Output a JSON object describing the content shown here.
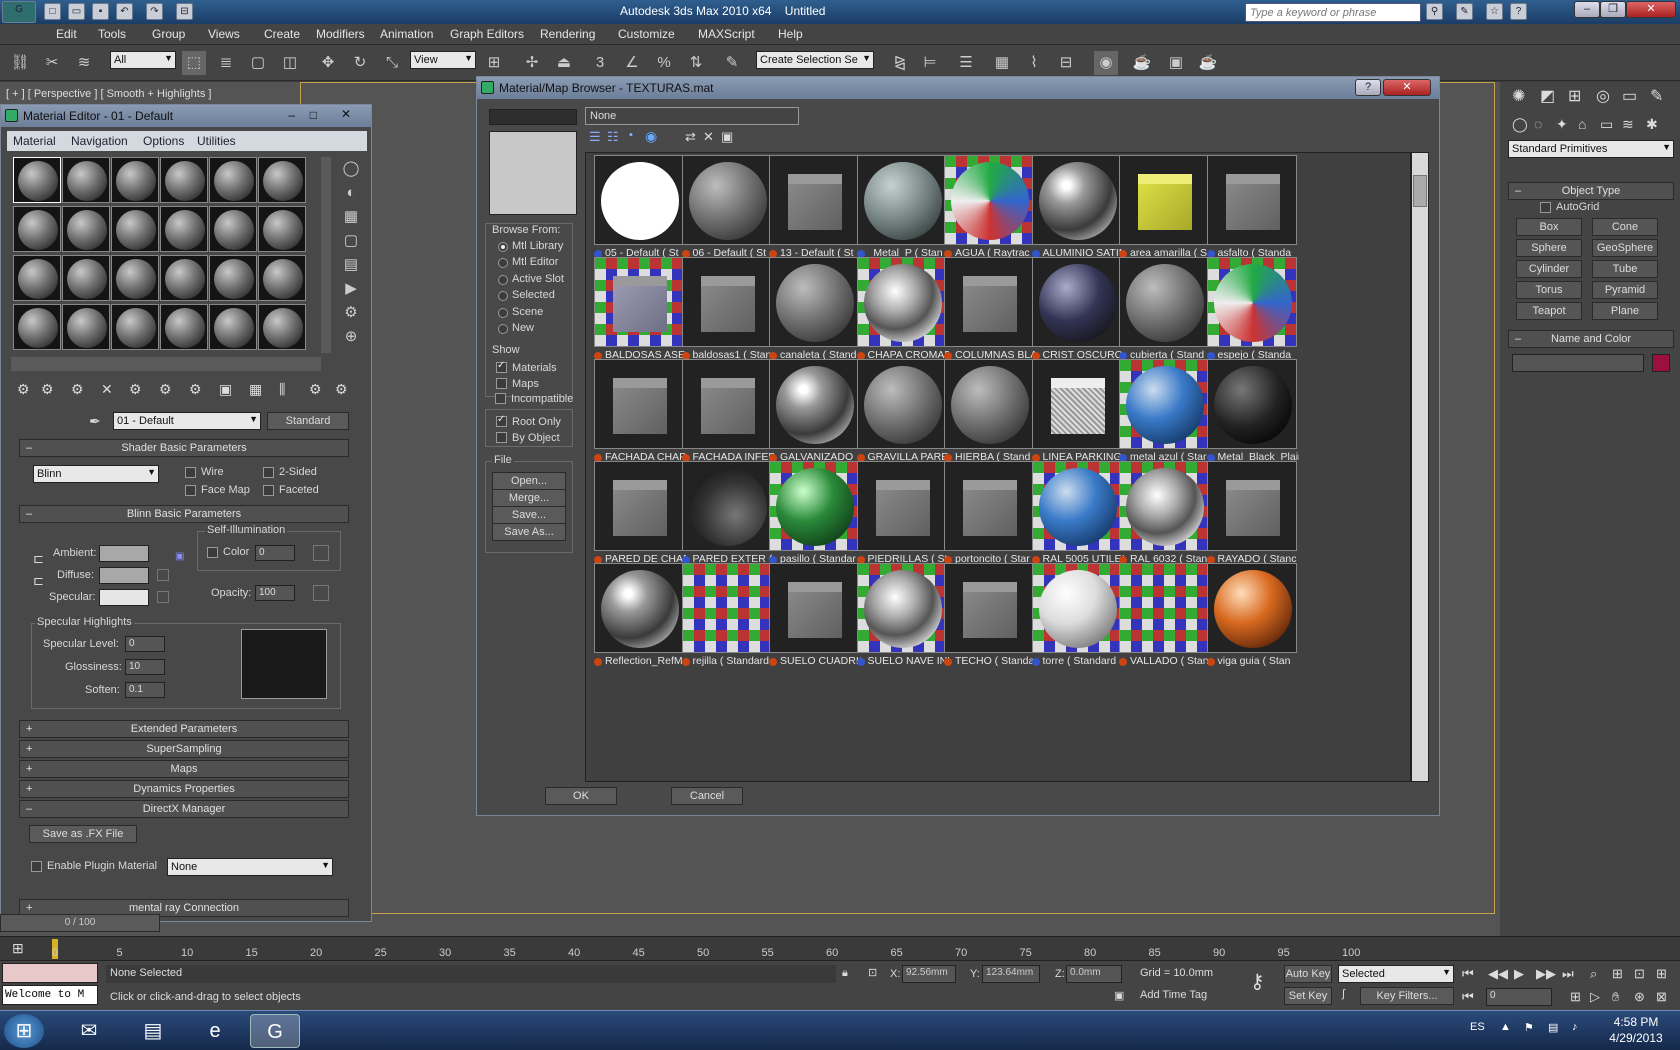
{
  "app": {
    "title": "Autodesk 3ds Max  2010 x64",
    "document": "Untitled",
    "search_placeholder": "Type a keyword or phrase"
  },
  "menu": [
    "Edit",
    "Tools",
    "Group",
    "Views",
    "Create",
    "Modifiers",
    "Animation",
    "Graph Editors",
    "Rendering",
    "Customize",
    "MAXScript",
    "Help"
  ],
  "toolbar": {
    "filter": "All",
    "ref_coord": "View",
    "selection_set": "Create Selection Se"
  },
  "viewport": {
    "label": "[ + ] [ Perspective ] [ Smooth + Highlights ]"
  },
  "material_editor": {
    "title": "Material Editor - 01 - Default",
    "menu": [
      "Material",
      "Navigation",
      "Options",
      "Utilities"
    ],
    "material_name": "01 - Default",
    "material_type": "Standard",
    "shader_rollout": "Shader Basic Parameters",
    "shader": "Blinn",
    "wire": "Wire",
    "two_sided": "2-Sided",
    "face_map": "Face Map",
    "faceted": "Faceted",
    "blinn_rollout": "Blinn Basic Parameters",
    "self_illum": "Self-Illumination",
    "color_label": "Color",
    "color_value": "0",
    "ambient": "Ambient:",
    "diffuse": "Diffuse:",
    "specular": "Specular:",
    "opacity_label": "Opacity:",
    "opacity_value": "100",
    "spec_highlights": "Specular Highlights",
    "spec_level_label": "Specular Level:",
    "spec_level": "0",
    "glossiness_label": "Glossiness:",
    "glossiness": "10",
    "soften_label": "Soften:",
    "soften": "0.1",
    "rollouts": [
      "Extended Parameters",
      "SuperSampling",
      "Maps",
      "Dynamics Properties"
    ],
    "directx": "DirectX Manager",
    "save_fx": "Save as .FX File",
    "enable_plugin": "Enable Plugin Material",
    "plugin_value": "None",
    "mental_ray": "mental ray Connection"
  },
  "browser": {
    "title": "Material/Map Browser - TEXTURAS.mat",
    "name_field": "None",
    "browse_from_label": "Browse From:",
    "browse_from": [
      "Mtl Library",
      "Mtl Editor",
      "Active Slot",
      "Selected",
      "Scene",
      "New"
    ],
    "show_label": "Show",
    "show": [
      "Materials",
      "Maps",
      "Incompatible"
    ],
    "root_only": "Root Only",
    "by_object": "By Object",
    "file_label": "File",
    "file_buttons": [
      "Open...",
      "Merge...",
      "Save...",
      "Save As..."
    ],
    "ok": "OK",
    "cancel": "Cancel",
    "materials": [
      {
        "name": "05 - Default  ( St",
        "thumb": "white",
        "dot": "blue"
      },
      {
        "name": "06 - Default  ( St",
        "thumb": "gray",
        "dot": "red"
      },
      {
        "name": "13 - Default  ( St",
        "thumb": "cube",
        "dot": "red"
      },
      {
        "name": "_Metal_P  ( Stan",
        "thumb": "teal",
        "dot": "blue"
      },
      {
        "name": "AGUA  ( Raytrac",
        "thumb": "noise",
        "dot": "red"
      },
      {
        "name": "ALUMINIO SATIN",
        "thumb": "chrome",
        "dot": "blue"
      },
      {
        "name": "area amarilla  ( S",
        "thumb": "yellowcube",
        "dot": "red"
      },
      {
        "name": "asfalto  ( Standa",
        "thumb": "cube",
        "dot": "blue"
      },
      {
        "name": "BALDOSAS ASEO",
        "thumb": "bluecube",
        "dot": "red"
      },
      {
        "name": "baldosas1  ( Stan",
        "thumb": "cube",
        "dot": "red"
      },
      {
        "name": "canaleta  ( Stand",
        "thumb": "gray",
        "dot": "red"
      },
      {
        "name": "CHAPA CROMAD",
        "thumb": "mirror",
        "dot": "red"
      },
      {
        "name": "COLUMNAS BLAN",
        "thumb": "cube",
        "dot": "red"
      },
      {
        "name": "CRIST OSCURO",
        "thumb": "darkblue",
        "dot": "red"
      },
      {
        "name": "cubierta  ( Stand",
        "thumb": "gray",
        "dot": "blue"
      },
      {
        "name": "espejo  ( Standa",
        "thumb": "noise",
        "dot": "blue"
      },
      {
        "name": "FACHADA CHAPA",
        "thumb": "cube",
        "dot": "red"
      },
      {
        "name": "FACHADA INFER",
        "thumb": "cube",
        "dot": "red"
      },
      {
        "name": "GALVANIZADO",
        "thumb": "chrome",
        "dot": "red"
      },
      {
        "name": "GRAVILLA PARE",
        "thumb": "gray",
        "dot": "red"
      },
      {
        "name": "HIERBA  ( Stand",
        "thumb": "gray",
        "dot": "red"
      },
      {
        "name": "LINEA PARKING",
        "thumb": "whitecube",
        "dot": "red"
      },
      {
        "name": "metal azul  ( Star",
        "thumb": "blue",
        "dot": "blue"
      },
      {
        "name": "Metal_Black_Plain",
        "thumb": "black",
        "dot": "blue"
      },
      {
        "name": "PARED DE CHAP",
        "thumb": "cube",
        "dot": "red"
      },
      {
        "name": "PARED EXTER  (",
        "thumb": "dark",
        "dot": "blue"
      },
      {
        "name": "pasillo  ( Standar",
        "thumb": "green",
        "dot": "blue"
      },
      {
        "name": "PIEDRILLAS  ( Sta",
        "thumb": "cube",
        "dot": "red"
      },
      {
        "name": "portoncito  ( Star",
        "thumb": "cube",
        "dot": "red"
      },
      {
        "name": "RAL 5005 UTILES",
        "thumb": "blue",
        "dot": "red"
      },
      {
        "name": "RAL 6032  ( Stan",
        "thumb": "mirror",
        "dot": "red"
      },
      {
        "name": "RAYADO  ( Stanc",
        "thumb": "cube",
        "dot": "red"
      },
      {
        "name": "Reflection_RefM",
        "thumb": "chrome",
        "dot": "red"
      },
      {
        "name": "rejilla  ( Standard",
        "thumb": "checker",
        "dot": "red"
      },
      {
        "name": "SUELO CUADRIC",
        "thumb": "cube",
        "dot": "red"
      },
      {
        "name": "SUELO NAVE IND",
        "thumb": "mirror",
        "dot": "blue"
      },
      {
        "name": "TECHO  ( Standa",
        "thumb": "cube",
        "dot": "red"
      },
      {
        "name": "torre  ( Standard",
        "thumb": "pearl",
        "dot": "blue"
      },
      {
        "name": "VALLADO  ( Stan",
        "thumb": "checker",
        "dot": "red"
      },
      {
        "name": "viga guia  ( Stan",
        "thumb": "orange",
        "dot": "red"
      }
    ]
  },
  "command_panel": {
    "category": "Standard Primitives",
    "object_type": "Object Type",
    "autogrid": "AutoGrid",
    "buttons": [
      "Box",
      "Cone",
      "Sphere",
      "GeoSphere",
      "Cylinder",
      "Tube",
      "Torus",
      "Pyramid",
      "Teapot",
      "Plane"
    ],
    "name_color": "Name and Color",
    "color": "#9a1040"
  },
  "timeline": {
    "frame": "0 / 100",
    "ticks": [
      "0",
      "5",
      "10",
      "15",
      "20",
      "25",
      "30",
      "35",
      "40",
      "45",
      "50",
      "55",
      "60",
      "65",
      "70",
      "75",
      "80",
      "85",
      "90",
      "95",
      "100"
    ]
  },
  "status": {
    "listener": "Welcome to M",
    "selection": "None Selected",
    "prompt": "Click or click-and-drag to select objects",
    "x_label": "X:",
    "x": "92.56mm",
    "y_label": "Y:",
    "y": "123.64mm",
    "z_label": "Z:",
    "z": "0.0mm",
    "grid": "Grid = 10.0mm",
    "add_time_tag": "Add Time Tag",
    "auto_key": "Auto Key",
    "auto_key_mode": "Selected",
    "set_key": "Set Key",
    "key_filters": "Key Filters...",
    "frame_field": "0"
  },
  "taskbar": {
    "lang": "ES",
    "time": "4:58 PM",
    "date": "4/29/2013"
  }
}
